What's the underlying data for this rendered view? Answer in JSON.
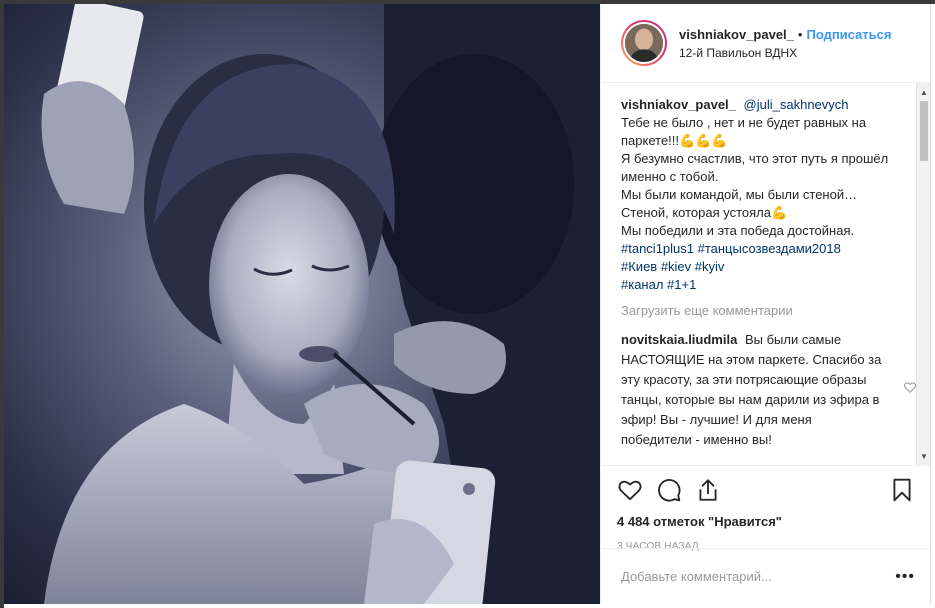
{
  "post": {
    "username": "vishniakov_pavel_",
    "separator": "•",
    "follow_label": "Подписаться",
    "location": "12-й Павильон ВДНХ",
    "avatar_icon": "profile-photo",
    "photo_icon": "post-photo"
  },
  "caption": {
    "username": "vishniakov_pavel_",
    "mention": "@juli_sakhnevych",
    "lines": [
      "Тебе не было , нет и не будет равных на паркете!!!💪💪💪",
      "Я безумно счастлив, что этот путь я прошёл именно с тобой.",
      "Мы были командой, мы были стеной…",
      "Стеной, которая устояла💪",
      "Мы победили и эта победа достойная."
    ],
    "tags_line1": "#tanci1plus1 #танцысозвездами2018",
    "tags_line2": "#Киев #kiev #kyiv",
    "tags_line3": "#канал #1+1"
  },
  "load_more_label": "Загрузить еще комментарии",
  "comments": [
    {
      "username": "novitskaia.liudmila",
      "text": "Вы были самые НАСТОЯЩИЕ на этом паркете. Спасибо за эту красоту, за эти потрясающие образы танцы, которые вы нам дарили из эфира в эфир! Вы - лучшие! И для меня победители - именно вы!"
    }
  ],
  "actions": {
    "like_icon": "heart-icon",
    "comment_icon": "comment-icon",
    "share_icon": "share-icon",
    "save_icon": "bookmark-icon"
  },
  "likes_label": "4 484 отметок \"Нравится\"",
  "time_label": "3 часов назад",
  "add_comment": {
    "placeholder": "Добавьте комментарий...",
    "more_label": "•••"
  },
  "colors": {
    "link_blue": "#3897f0",
    "tag_blue": "#003569",
    "muted": "#999999"
  }
}
